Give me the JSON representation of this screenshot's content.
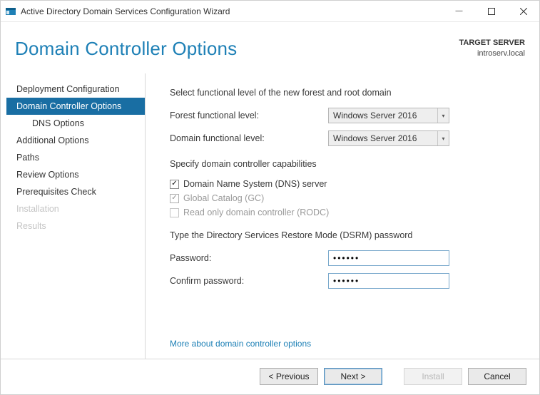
{
  "window": {
    "title": "Active Directory Domain Services Configuration Wizard"
  },
  "header": {
    "page_title": "Domain Controller Options",
    "target_label": "TARGET SERVER",
    "target_value": "introserv.local"
  },
  "sidebar": {
    "items": [
      {
        "label": "Deployment Configuration",
        "state": "enabled"
      },
      {
        "label": "Domain Controller Options",
        "state": "selected"
      },
      {
        "label": "DNS Options",
        "state": "enabled",
        "sub": true
      },
      {
        "label": "Additional Options",
        "state": "enabled"
      },
      {
        "label": "Paths",
        "state": "enabled"
      },
      {
        "label": "Review Options",
        "state": "enabled"
      },
      {
        "label": "Prerequisites Check",
        "state": "enabled"
      },
      {
        "label": "Installation",
        "state": "disabled"
      },
      {
        "label": "Results",
        "state": "disabled"
      }
    ]
  },
  "content": {
    "func_level_text": "Select functional level of the new forest and root domain",
    "forest_label": "Forest functional level:",
    "forest_value": "Windows Server 2016",
    "domain_label": "Domain functional level:",
    "domain_value": "Windows Server 2016",
    "caps_text": "Specify domain controller capabilities",
    "dns_label": "Domain Name System (DNS) server",
    "gc_label": "Global Catalog (GC)",
    "rodc_label": "Read only domain controller (RODC)",
    "dsrm_text": "Type the Directory Services Restore Mode (DSRM) password",
    "pw_label": "Password:",
    "pw_value": "••••••",
    "cpw_label": "Confirm password:",
    "cpw_value": "••••••",
    "more_link": "More about domain controller options"
  },
  "footer": {
    "previous": "< Previous",
    "next": "Next >",
    "install": "Install",
    "cancel": "Cancel"
  }
}
